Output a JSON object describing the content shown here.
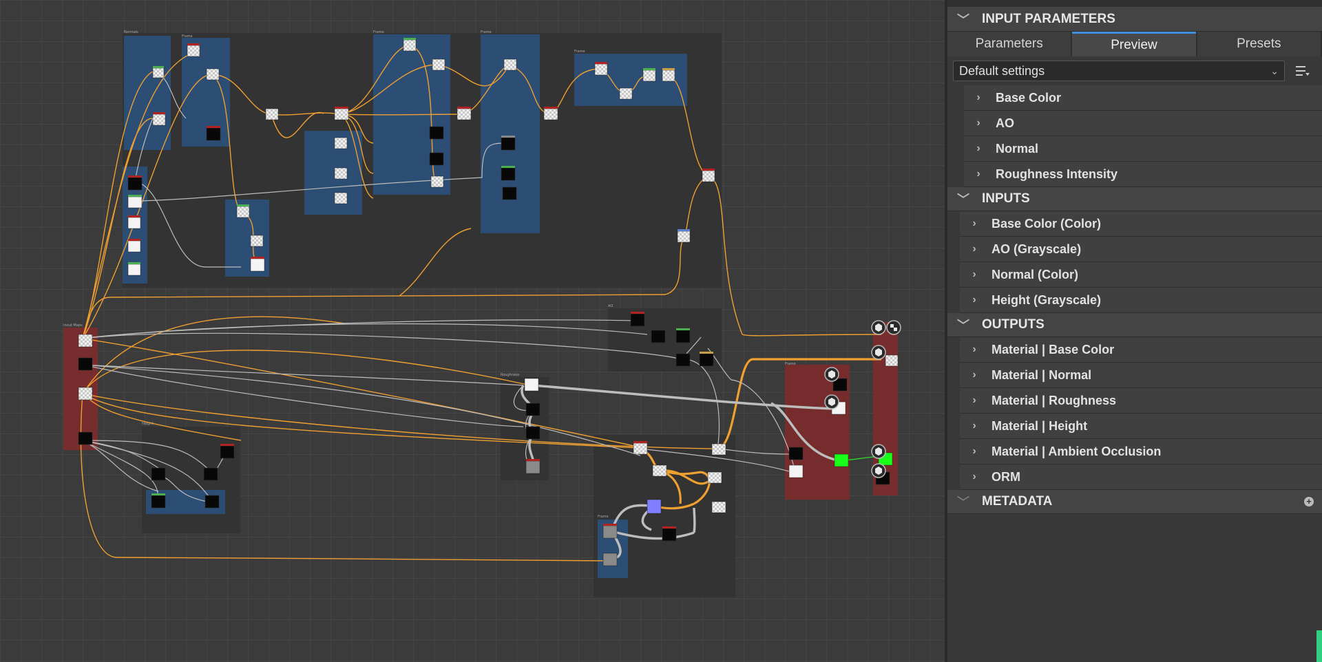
{
  "panel": {
    "sections": {
      "input_parameters": "INPUT PARAMETERS",
      "inputs": "INPUTS",
      "outputs": "OUTPUTS",
      "metadata": "METADATA"
    },
    "tabs": [
      {
        "label": "Parameters"
      },
      {
        "label": "Preview"
      },
      {
        "label": "Presets"
      }
    ],
    "active_tab": "Preview",
    "preset": {
      "selected": "Default settings"
    },
    "parameter_groups": [
      {
        "label": "Base Color"
      },
      {
        "label": "AO"
      },
      {
        "label": "Normal"
      },
      {
        "label": "Roughness Intensity"
      }
    ],
    "inputs": [
      {
        "label": "Base Color (Color)"
      },
      {
        "label": "AO (Grayscale)"
      },
      {
        "label": "Normal (Color)"
      },
      {
        "label": "Height (Grayscale)"
      }
    ],
    "outputs": [
      {
        "label": "Material | Base Color"
      },
      {
        "label": "Material | Normal"
      },
      {
        "label": "Material | Roughness"
      },
      {
        "label": "Material | Height"
      },
      {
        "label": "Material | Ambient Occlusion"
      },
      {
        "label": "ORM"
      }
    ]
  },
  "icons": {
    "chevron_collapsed": "chevron-right-icon",
    "chevron_expanded": "chevron-down-icon",
    "dropdown": "chevron-down-icon",
    "menu": "list-menu-icon",
    "add": "plus-circle-icon",
    "output_node": "cube-icon"
  },
  "colors": {
    "accent_tab": "#3f8fe0",
    "wire_color": "#f0a030",
    "wire_gray": "#bdbdbd",
    "frame_blue": "#2c4f78",
    "frame_red": "#7a2a2a",
    "scroll_accent": "#2fcf7f"
  }
}
